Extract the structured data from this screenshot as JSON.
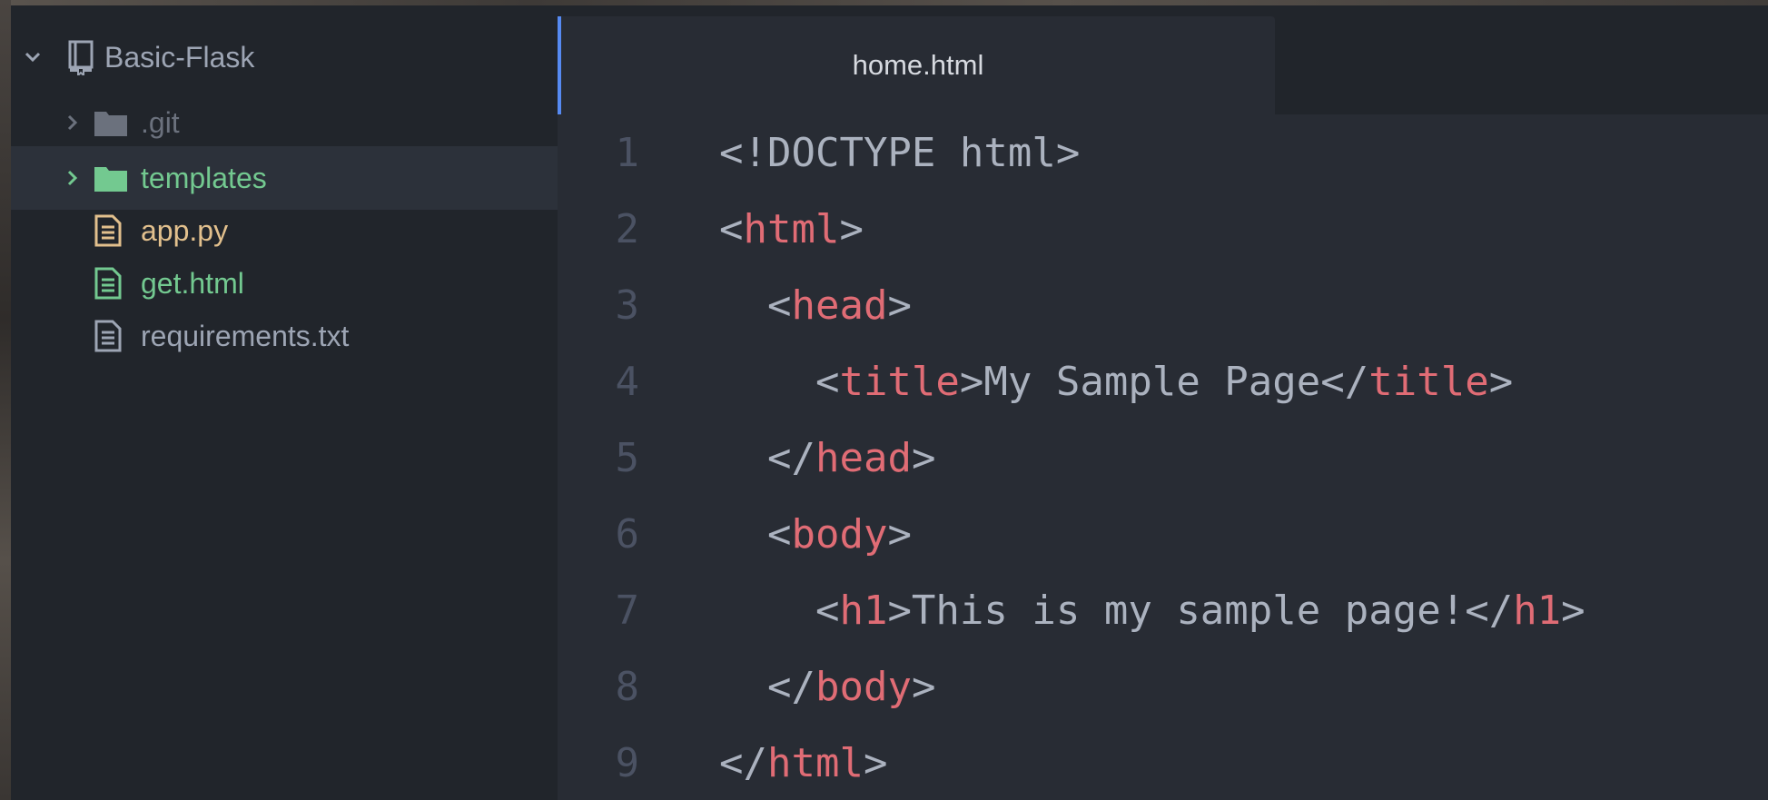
{
  "tree": {
    "project": "Basic-Flask",
    "items": [
      {
        "label": ".git",
        "kind": "folder",
        "state": "ignored",
        "icon": "folder-icon"
      },
      {
        "label": "templates",
        "kind": "folder",
        "state": "added",
        "icon": "folder-icon"
      },
      {
        "label": "app.py",
        "kind": "file",
        "state": "modified",
        "icon": "file-text-icon"
      },
      {
        "label": "get.html",
        "kind": "file",
        "state": "added",
        "icon": "file-text-icon"
      },
      {
        "label": "requirements.txt",
        "kind": "file",
        "state": "unchanged",
        "icon": "file-text-icon"
      }
    ]
  },
  "editor": {
    "tab_title": "home.html",
    "lines": [
      {
        "num": "1",
        "segments": [
          {
            "text": "<!DOCTYPE html>",
            "cls": "p"
          }
        ]
      },
      {
        "num": "2",
        "segments": [
          {
            "text": "<",
            "cls": "p"
          },
          {
            "text": "html",
            "cls": "t"
          },
          {
            "text": ">",
            "cls": "p"
          }
        ]
      },
      {
        "num": "3",
        "segments": [
          {
            "text": "  <",
            "cls": "p"
          },
          {
            "text": "head",
            "cls": "t"
          },
          {
            "text": ">",
            "cls": "p"
          }
        ]
      },
      {
        "num": "4",
        "segments": [
          {
            "text": "    <",
            "cls": "p"
          },
          {
            "text": "title",
            "cls": "t"
          },
          {
            "text": ">My Sample Page</",
            "cls": "p"
          },
          {
            "text": "title",
            "cls": "t"
          },
          {
            "text": ">",
            "cls": "p"
          }
        ]
      },
      {
        "num": "5",
        "segments": [
          {
            "text": "  </",
            "cls": "p"
          },
          {
            "text": "head",
            "cls": "t"
          },
          {
            "text": ">",
            "cls": "p"
          }
        ]
      },
      {
        "num": "6",
        "segments": [
          {
            "text": "  <",
            "cls": "p"
          },
          {
            "text": "body",
            "cls": "t"
          },
          {
            "text": ">",
            "cls": "p"
          }
        ]
      },
      {
        "num": "7",
        "segments": [
          {
            "text": "    <",
            "cls": "p"
          },
          {
            "text": "h1",
            "cls": "t"
          },
          {
            "text": ">This is my sample page!</",
            "cls": "p"
          },
          {
            "text": "h1",
            "cls": "t"
          },
          {
            "text": ">",
            "cls": "p"
          }
        ]
      },
      {
        "num": "8",
        "segments": [
          {
            "text": "  </",
            "cls": "p"
          },
          {
            "text": "body",
            "cls": "t"
          },
          {
            "text": ">",
            "cls": "p"
          }
        ]
      },
      {
        "num": "9",
        "segments": [
          {
            "text": "</",
            "cls": "p"
          },
          {
            "text": "html",
            "cls": "t"
          },
          {
            "text": ">",
            "cls": "p"
          }
        ]
      }
    ]
  },
  "colors": {
    "tree_bg": "#21252b",
    "editor_bg": "#282c34",
    "tag": "#e06c75",
    "text": "#abb2bf",
    "git_added": "#73c990",
    "git_modified": "#e2c08d",
    "git_ignored": "#6b717d",
    "tab_accent": "#568af2"
  }
}
